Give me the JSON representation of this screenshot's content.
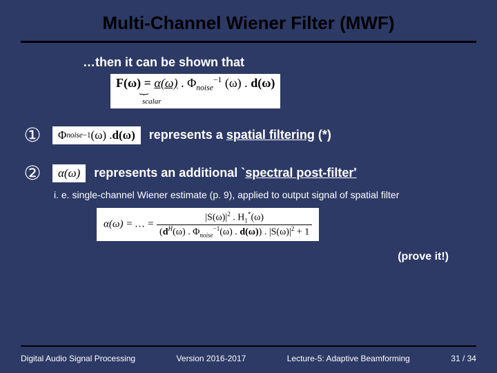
{
  "title": "Multi-Channel Wiener Filter (MWF)",
  "intro": "…then it can be shown that",
  "main_eq": {
    "F": "F(ω) = ",
    "alpha": "α(ω)",
    "dot1": " . ",
    "phi": "Φ",
    "phi_sub": "noise",
    "phi_sup": "−1",
    "arg": "(ω) . ",
    "d": "d(ω)",
    "scalar_label": "scalar"
  },
  "row1": {
    "num": "①",
    "phi": "Φ",
    "phi_sub": "noise",
    "phi_sup": "−1",
    "arg": "(ω) . ",
    "d": "d(ω)",
    "desc_pre": "represents a  ",
    "desc_under": "spatial filtering",
    "desc_post": "  (*)"
  },
  "row2": {
    "num": "②",
    "eq": "α(ω)",
    "desc_pre": "represents an additional `",
    "desc_under": "spectral post-filter'"
  },
  "note": "i. e. single-channel Wiener estimate (p. 9), applied to output signal of spatial filter",
  "big_eq": {
    "lhs": "α(ω) = … = ",
    "num_a": "|S(ω)|",
    "num_exp": "2",
    "num_dot": " . H",
    "num_h_sub": "1",
    "num_h_sup": "*",
    "num_tail": "(ω)",
    "den_open": "(",
    "den_d": "d",
    "den_d_sup": "H",
    "den_mid": "(ω) . Φ",
    "den_phi_sub": "noise",
    "den_phi_sup": "−1",
    "den_mid2": "(ω) . ",
    "den_d2": "d(ω)",
    "den_close": ") . |S(ω)|",
    "den_exp": "2",
    "den_plus": " + 1"
  },
  "prove": "(prove it!)",
  "footer": {
    "left": "Digital Audio Signal Processing",
    "mid": "Version 2016-2017",
    "right1": "Lecture-5: Adaptive Beamforming",
    "right2": "31 / 34"
  }
}
